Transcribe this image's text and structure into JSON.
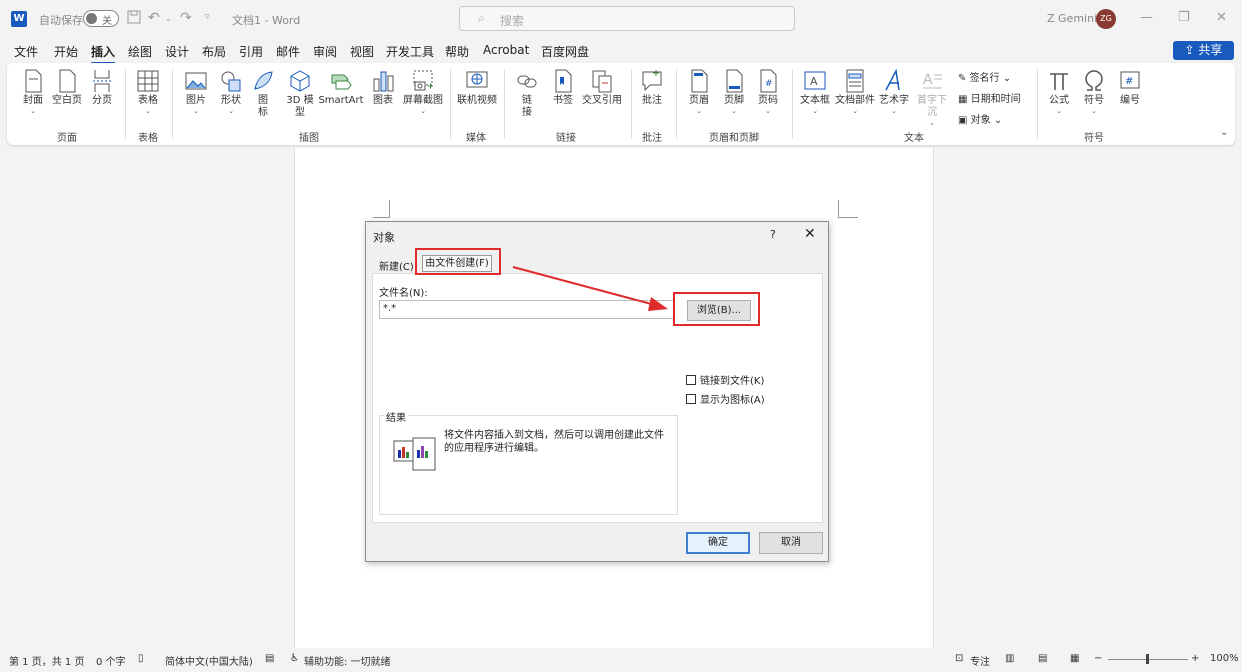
{
  "titlebar": {
    "app_logo": "W",
    "autosave_label": "自动保存",
    "toggle_state": "关",
    "document_title": "文档1 - Word",
    "search_placeholder": "搜索",
    "user_name": "Z Gemini",
    "user_initials": "ZG",
    "icons": [
      "save-icon",
      "undo-icon",
      "redo-icon",
      "customize-icon"
    ]
  },
  "menu": {
    "items": [
      "文件",
      "开始",
      "插入",
      "绘图",
      "设计",
      "布局",
      "引用",
      "邮件",
      "审阅",
      "视图",
      "开发工具",
      "帮助",
      "Acrobat",
      "百度网盘"
    ],
    "active": "插入",
    "share_label": "共享"
  },
  "ribbon": {
    "groups": {
      "pages": "页面",
      "tables": "表格",
      "illustrations": "插图",
      "media": "媒体",
      "links": "链接",
      "comments": "批注",
      "header_footer": "页眉和页脚",
      "text": "文本",
      "symbols": "符号"
    },
    "buttons": {
      "cover": "封面",
      "blank_page": "空白页",
      "page_break": "分页",
      "table": "表格",
      "picture": "图片",
      "shapes": "形状",
      "icons_1": "图",
      "icons_2": "标",
      "model3d_1": "3D 模",
      "model3d_2": "型",
      "smartart": "SmartArt",
      "chart": "图表",
      "screenshot": "屏幕截图",
      "online_video": "联机视频",
      "link_1": "链",
      "link_2": "接",
      "bookmark": "书签",
      "cross_ref": "交叉引用",
      "comment": "批注",
      "header": "页眉",
      "footer": "页脚",
      "page_number": "页码",
      "textbox": "文本框",
      "quick_parts": "文档部件",
      "wordart": "艺术字",
      "dropcap": "首字下沉",
      "signature_line": "签名行",
      "date_time": "日期和时间",
      "object": "对象",
      "equation": "公式",
      "symbol": "符号",
      "number": "编号"
    }
  },
  "dialog": {
    "title": "对象",
    "help": "?",
    "close": "✕",
    "tab_new": "新建(C)",
    "tab_from_file": "由文件创建(F)",
    "filename_label": "文件名(N):",
    "filename_value": "*.*",
    "browse": "浏览(B)...",
    "link_to_file": "链接到文件(K)",
    "display_as_icon": "显示为图标(A)",
    "result_label": "结果",
    "result_text": "将文件内容插入到文档，然后可以调用创建此文件的应用程序进行编辑。",
    "ok": "确定",
    "cancel": "取消"
  },
  "statusbar": {
    "page": "第 1 页，共 1 页",
    "words": "0 个字",
    "language": "简体中文(中国大陆)",
    "accessibility": "辅助功能: 一切就绪",
    "focus": "专注",
    "zoom": "100%"
  },
  "colors": {
    "accent": "#185abd",
    "highlight": "#e02b2b",
    "avatar": "#8a3a32"
  }
}
